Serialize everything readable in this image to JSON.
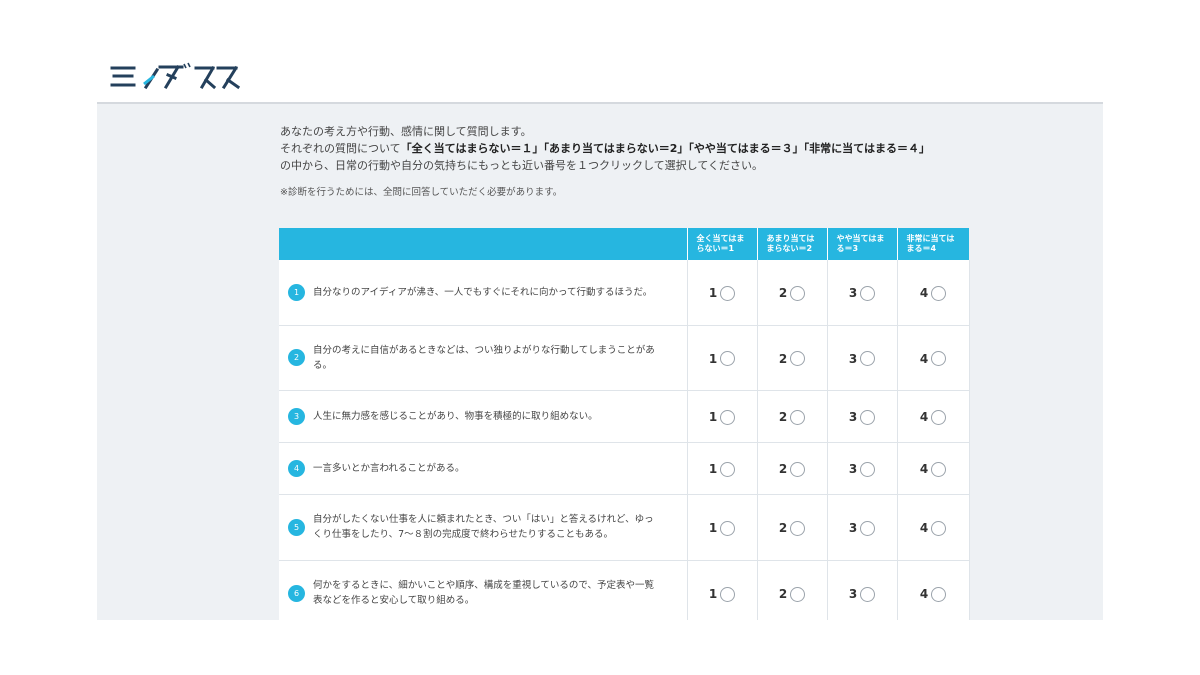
{
  "brand": {
    "logo_text": "ミイダス",
    "accent_color": "#26b6e0"
  },
  "intro": {
    "line1": "あなたの考え方や行動、感情に関して質問します。",
    "line2_prefix": "それぞれの質問について",
    "line2_scale": "「全く当てはまらない＝１」「あまり当てはまらない＝2」「やや当てはまる＝３」「非常に当てはまる＝４」",
    "line3": "の中から、日常の行動や自分の気持ちにもっとも近い番号を１つクリックして選択してください。",
    "note": "※診断を行うためには、全問に回答していただく必要があります。"
  },
  "table": {
    "headers": [
      {
        "line1": "全く当てはま",
        "line2": "らない＝1"
      },
      {
        "line1": "あまり当ては",
        "line2": "まらない＝2"
      },
      {
        "line1": "やや当てはま",
        "line2": "る＝3"
      },
      {
        "line1": "非常に当ては",
        "line2": "まる＝4"
      }
    ],
    "option_labels": [
      "1",
      "2",
      "3",
      "4"
    ],
    "questions": [
      {
        "num": "1",
        "text": "自分なりのアイディアが沸き、一人でもすぐにそれに向かって行動するほうだ。"
      },
      {
        "num": "2",
        "text": "自分の考えに自信があるときなどは、つい独りよがりな行動してしまうことがある。"
      },
      {
        "num": "3",
        "text": "人生に無力感を感じることがあり、物事を積極的に取り組めない。"
      },
      {
        "num": "4",
        "text": "一言多いとか言われることがある。"
      },
      {
        "num": "5",
        "text": "自分がしたくない仕事を人に頼まれたとき、つい「はい」と答えるけれど、ゆっくり仕事をしたり、7〜８割の完成度で終わらせたりすることもある。"
      },
      {
        "num": "6",
        "text": "何かをするときに、細かいことや順序、構成を重視しているので、予定表や一覧表などを作ると安心して取り組める。"
      }
    ]
  }
}
